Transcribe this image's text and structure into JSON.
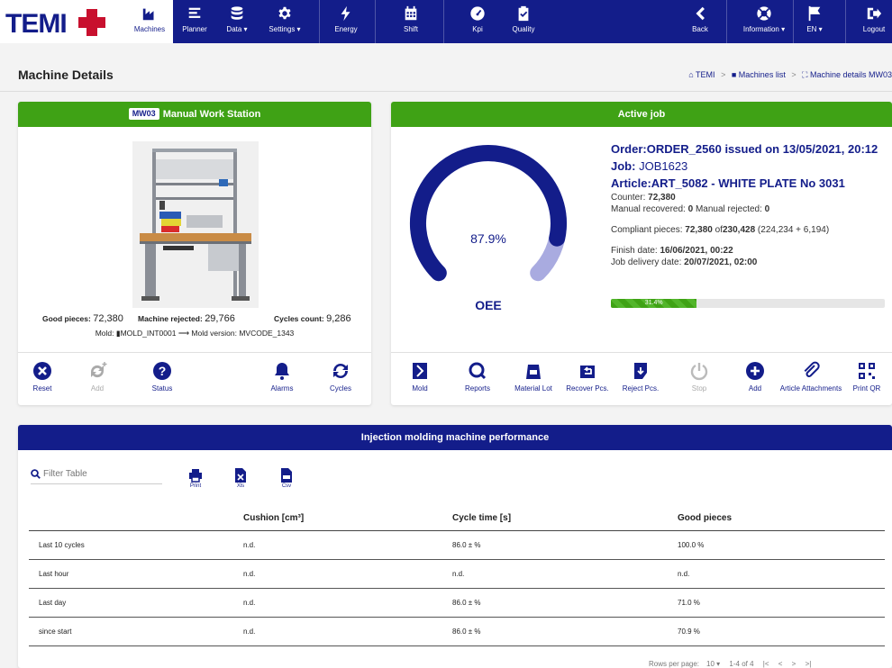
{
  "nav": {
    "items": [
      {
        "label": "Machines",
        "icon": "factory-icon"
      },
      {
        "label": "Planner",
        "icon": "list-icon"
      },
      {
        "label": "Data ▾",
        "icon": "database-icon"
      },
      {
        "label": "Settings ▾",
        "icon": "gear-icon"
      },
      {
        "label": "Energy",
        "icon": "bolt-icon"
      },
      {
        "label": "Shift",
        "icon": "calendar-icon"
      },
      {
        "label": "Kpi",
        "icon": "speedometer-icon"
      },
      {
        "label": "Quality",
        "icon": "clipboard-check-icon"
      },
      {
        "label": "Back",
        "icon": "chevron-left-icon"
      },
      {
        "label": "Information ▾",
        "icon": "lifebuoy-icon"
      },
      {
        "label": "EN ▾",
        "icon": "flag-icon"
      },
      {
        "label": "Logout",
        "icon": "logout-icon"
      }
    ],
    "colors": {
      "bar": "#131d8a",
      "accent": "#3fa215"
    }
  },
  "page": {
    "title": "Machine Details"
  },
  "breadcrumb": {
    "home": "TEMI",
    "list": "Machines list",
    "current": "Machine details MW03"
  },
  "machine": {
    "code": "MW03",
    "name": "Manual Work Station",
    "good_label": "Good pieces:",
    "good_value": "72,380",
    "rejected_label": "Machine rejected:",
    "rejected_value": "29,766",
    "cycles_label": "Cycles count:",
    "cycles_value": "9,286",
    "mold_label": "Mold:",
    "mold_value": "MOLD_INT0001",
    "mold_version_label": "Mold version:",
    "mold_version_value": "MVCODE_1343",
    "actions": [
      "Reset",
      "Add",
      "Status",
      "Alarms",
      "Cycles"
    ]
  },
  "job": {
    "header": "Active job",
    "oee_value": "87.9%",
    "oee_fraction": 0.879,
    "oee_label": "OEE",
    "order": "Order:ORDER_2560 issued on 13/05/2021, 20:12",
    "job_prefix": "Job:",
    "job_value": "JOB1623",
    "article": "Article:ART_5082 - WHITE PLATE No 3031",
    "counter_label": "Counter:",
    "counter_value": "72,380",
    "manual_rec_label": "Manual recovered:",
    "manual_rec_value": "0",
    "manual_rej_label": "Manual rejected:",
    "manual_rej_value": "0",
    "compliant_label": "Compliant pieces:",
    "compliant_value": "72,380",
    "compliant_of": "of",
    "compliant_total": "230,428",
    "compliant_detail": "(224,234 + 6,194)",
    "finish_label": "Finish date:",
    "finish_value": "16/06/2021, 00:22",
    "delivery_label": "Job delivery date:",
    "delivery_value": "20/07/2021, 02:00",
    "progress_label": "31.4%",
    "progress_fraction": 0.314,
    "actions": [
      "Mold",
      "Reports",
      "Material Lot",
      "Recover Pcs.",
      "Reject Pcs.",
      "Stop",
      "Add",
      "Article Attachments",
      "Print QR"
    ]
  },
  "performance": {
    "title": "Injection molding machine performance",
    "filter_placeholder": "Filter Table",
    "exports": [
      "Print",
      "Xls",
      "Csv"
    ],
    "columns": [
      "",
      "Cushion [cm³]",
      "Cycle time [s]",
      "Good pieces"
    ],
    "rows": [
      [
        "Last 10 cycles",
        "n.d.",
        "86.0 ± %",
        "100.0 %"
      ],
      [
        "Last hour",
        "n.d.",
        "n.d.",
        "n.d."
      ],
      [
        "Last day",
        "n.d.",
        "86.0 ± %",
        "71.0 %"
      ],
      [
        "since start",
        "n.d.",
        "86.0 ± %",
        "70.9 %"
      ]
    ],
    "rows_per_page_label": "Rows per page:",
    "rows_per_page_value": "10 ▾",
    "range": "1-4 of 4",
    "pager_first": "|<",
    "pager_prev": "<",
    "pager_next": ">",
    "pager_last": ">|"
  }
}
